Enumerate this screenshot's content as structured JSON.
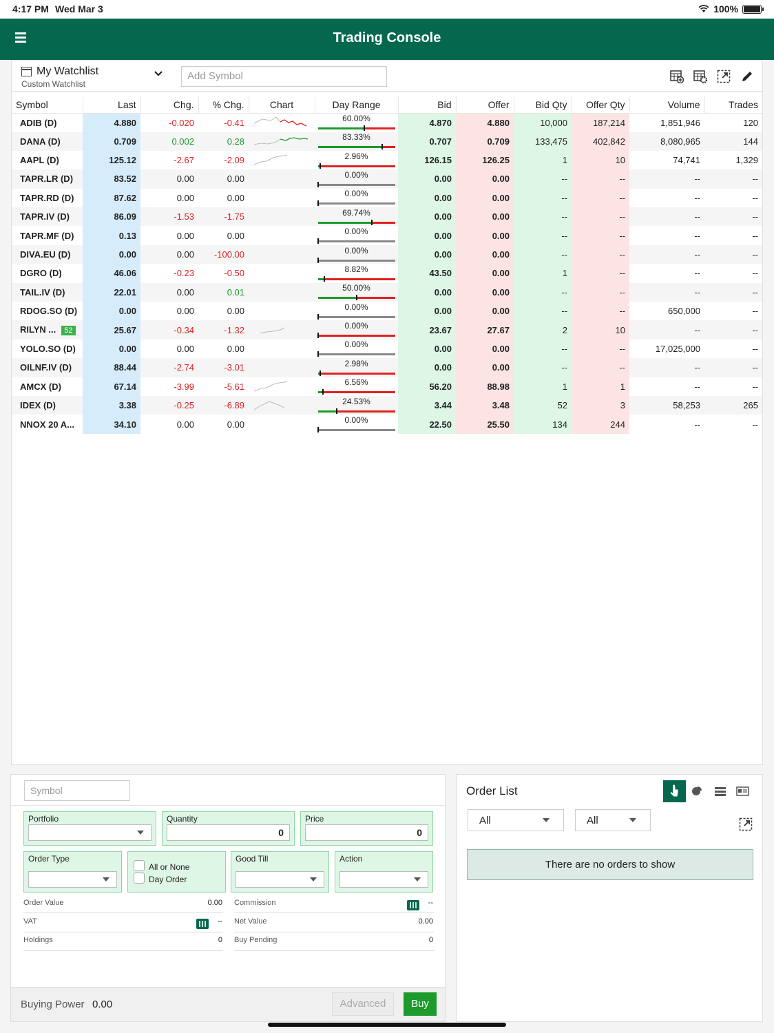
{
  "status": {
    "time": "4:17 PM",
    "date": "Wed Mar 3",
    "battery": "100%"
  },
  "app": {
    "title": "Trading Console"
  },
  "watchlist": {
    "name": "My Watchlist",
    "subtitle": "Custom Watchlist",
    "add_placeholder": "Add Symbol"
  },
  "columns": [
    "Symbol",
    "Last",
    "Chg.",
    "% Chg.",
    "Chart",
    "Day Range",
    "Bid",
    "Offer",
    "Bid Qty",
    "Offer Qty",
    "Volume",
    "Trades"
  ],
  "rows": [
    {
      "symbol": "ADIB (D)",
      "last": "4.880",
      "chg": "-0.020",
      "pchg": "-0.41",
      "range": "60.00%",
      "rv": 0.6,
      "bid": "4.870",
      "offer": "4.880",
      "bidqty": "10,000",
      "offerqty": "187,214",
      "volume": "1,851,946",
      "trades": "120",
      "dir": "neg",
      "chart": "mixed"
    },
    {
      "symbol": "DANA (D)",
      "last": "0.709",
      "chg": "0.002",
      "pchg": "0.28",
      "range": "83.33%",
      "rv": 0.8333,
      "bid": "0.707",
      "offer": "0.709",
      "bidqty": "133,475",
      "offerqty": "402,842",
      "volume": "8,080,965",
      "trades": "144",
      "dir": "pos",
      "chart": "mixed2"
    },
    {
      "symbol": "AAPL (D)",
      "last": "125.12",
      "chg": "-2.67",
      "pchg": "-2.09",
      "range": "2.96%",
      "rv": 0.0296,
      "bid": "126.15",
      "offer": "126.25",
      "bidqty": "1",
      "offerqty": "10",
      "volume": "74,741",
      "trades": "1,329",
      "dir": "neg",
      "chart": "gray"
    },
    {
      "symbol": "TAPR.LR (D)",
      "last": "83.52",
      "chg": "0.00",
      "pchg": "0.00",
      "range": "0.00%",
      "rv": 0,
      "bid": "0.00",
      "offer": "0.00",
      "bidqty": "--",
      "offerqty": "--",
      "volume": "--",
      "trades": "--",
      "dir": "none",
      "chart": ""
    },
    {
      "symbol": "TAPR.RD (D)",
      "last": "87.62",
      "chg": "0.00",
      "pchg": "0.00",
      "range": "0.00%",
      "rv": 0,
      "bid": "0.00",
      "offer": "0.00",
      "bidqty": "--",
      "offerqty": "--",
      "volume": "--",
      "trades": "--",
      "dir": "none",
      "chart": ""
    },
    {
      "symbol": "TAPR.IV (D)",
      "last": "86.09",
      "chg": "-1.53",
      "pchg": "-1.75",
      "range": "69.74%",
      "rv": 0.6974,
      "bid": "0.00",
      "offer": "0.00",
      "bidqty": "--",
      "offerqty": "--",
      "volume": "--",
      "trades": "--",
      "dir": "neg",
      "chart": ""
    },
    {
      "symbol": "TAPR.MF (D)",
      "last": "0.13",
      "chg": "0.00",
      "pchg": "0.00",
      "range": "0.00%",
      "rv": 0,
      "bid": "0.00",
      "offer": "0.00",
      "bidqty": "--",
      "offerqty": "--",
      "volume": "--",
      "trades": "--",
      "dir": "none",
      "chart": ""
    },
    {
      "symbol": "DIVA.EU (D)",
      "last": "0.00",
      "chg": "0.00",
      "pchg": "-100.00",
      "range": "0.00%",
      "rv": 0,
      "bid": "0.00",
      "offer": "0.00",
      "bidqty": "--",
      "offerqty": "--",
      "volume": "--",
      "trades": "--",
      "dir": "pneg",
      "chart": ""
    },
    {
      "symbol": "DGRO (D)",
      "last": "46.06",
      "chg": "-0.23",
      "pchg": "-0.50",
      "range": "8.82%",
      "rv": 0.0882,
      "bid": "43.50",
      "offer": "0.00",
      "bidqty": "1",
      "offerqty": "--",
      "volume": "--",
      "trades": "--",
      "dir": "neg",
      "chart": ""
    },
    {
      "symbol": "TAIL.IV (D)",
      "last": "22.01",
      "chg": "0.00",
      "pchg": "0.01",
      "range": "50.00%",
      "rv": 0.5,
      "bid": "0.00",
      "offer": "0.00",
      "bidqty": "--",
      "offerqty": "--",
      "volume": "--",
      "trades": "--",
      "dir": "ppos",
      "chart": ""
    },
    {
      "symbol": "RDOG.SO (D)",
      "last": "0.00",
      "chg": "0.00",
      "pchg": "0.00",
      "range": "0.00%",
      "rv": 0,
      "bid": "0.00",
      "offer": "0.00",
      "bidqty": "--",
      "offerqty": "--",
      "volume": "650,000",
      "trades": "--",
      "dir": "none",
      "chart": ""
    },
    {
      "symbol": "RILYN ...",
      "badge": "52",
      "last": "25.67",
      "chg": "-0.34",
      "pchg": "-1.32",
      "range": "0.00%",
      "rv": 0,
      "bid": "23.67",
      "offer": "27.67",
      "bidqty": "2",
      "offerqty": "10",
      "volume": "--",
      "trades": "--",
      "dir": "neg",
      "chart": "gray2"
    },
    {
      "symbol": "YOLO.SO (D)",
      "last": "0.00",
      "chg": "0.00",
      "pchg": "0.00",
      "range": "0.00%",
      "rv": 0,
      "bid": "0.00",
      "offer": "0.00",
      "bidqty": "--",
      "offerqty": "--",
      "volume": "17,025,000",
      "trades": "--",
      "dir": "none",
      "chart": ""
    },
    {
      "symbol": "OILNF.IV (D)",
      "last": "88.44",
      "chg": "-2.74",
      "pchg": "-3.01",
      "range": "2.98%",
      "rv": 0.0298,
      "bid": "0.00",
      "offer": "0.00",
      "bidqty": "--",
      "offerqty": "--",
      "volume": "--",
      "trades": "--",
      "dir": "neg",
      "chart": ""
    },
    {
      "symbol": "AMCX (D)",
      "last": "67.14",
      "chg": "-3.99",
      "pchg": "-5.61",
      "range": "6.56%",
      "rv": 0.0656,
      "bid": "56.20",
      "offer": "88.98",
      "bidqty": "1",
      "offerqty": "1",
      "volume": "--",
      "trades": "--",
      "dir": "neg",
      "chart": "gray"
    },
    {
      "symbol": "IDEX (D)",
      "last": "3.38",
      "chg": "-0.25",
      "pchg": "-6.89",
      "range": "24.53%",
      "rv": 0.2453,
      "bid": "3.44",
      "offer": "3.48",
      "bidqty": "52",
      "offerqty": "3",
      "volume": "58,253",
      "trades": "265",
      "dir": "neg",
      "chart": "gray3"
    },
    {
      "symbol": "NNOX 20 A...",
      "last": "34.10",
      "chg": "0.00",
      "pchg": "0.00",
      "range": "0.00%",
      "rv": 0,
      "bid": "22.50",
      "offer": "25.50",
      "bidqty": "134",
      "offerqty": "244",
      "volume": "--",
      "trades": "--",
      "dir": "none",
      "chart": ""
    }
  ],
  "order": {
    "symbol_placeholder": "Symbol",
    "portfolio_label": "Portfolio",
    "quantity_label": "Quantity",
    "quantity_value": "0",
    "price_label": "Price",
    "price_value": "0",
    "ordertype_label": "Order Type",
    "aon_label": "All or None",
    "dayorder_label": "Day Order",
    "goodtill_label": "Good Till",
    "action_label": "Action",
    "ordervalue_label": "Order Value",
    "ordervalue": "0.00",
    "commission_label": "Commission",
    "commission": "--",
    "vat_label": "VAT",
    "vat": "--",
    "netvalue_label": "Net Value",
    "netvalue": "0.00",
    "holdings_label": "Holdings",
    "holdings": "0",
    "buypending_label": "Buy Pending",
    "buypending": "0",
    "buyingpower_label": "Buying Power",
    "buyingpower": "0.00",
    "advanced_label": "Advanced",
    "buy_label": "Buy"
  },
  "orderlist": {
    "title": "Order List",
    "filter1": "All",
    "filter2": "All",
    "empty": "There are no orders to show"
  },
  "colors": {
    "brand": "#04684f",
    "positive": "#1c9a2c",
    "negative": "#e02020",
    "last_bg": "#d6ecfb",
    "bid_bg": "#def6e6",
    "offer_bg": "#fce4e4"
  }
}
